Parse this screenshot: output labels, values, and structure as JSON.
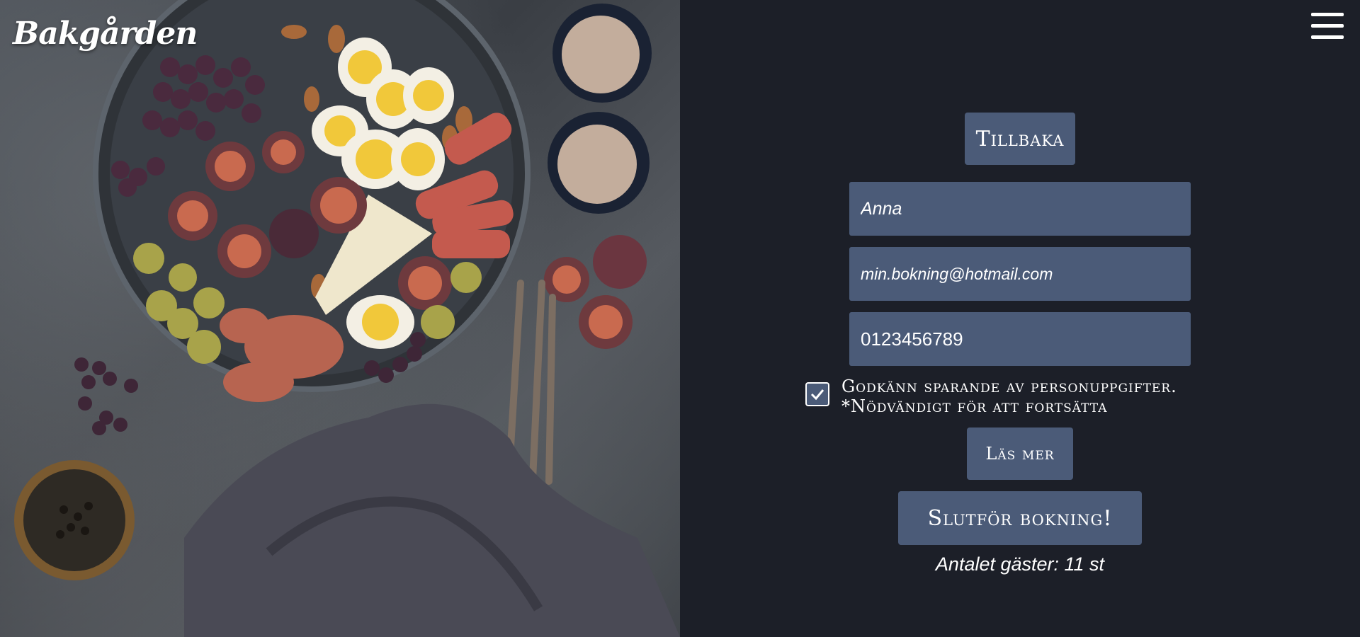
{
  "brand": {
    "logo_text": "Bakgården"
  },
  "header": {
    "menu_icon": "hamburger-menu-icon"
  },
  "form": {
    "back_label": "Tillbaka",
    "name_value": "Anna",
    "email_value": "min.bokning@hotmail.com",
    "phone_value": "0123456789",
    "consent_checked": true,
    "consent_line1": "Godkänn sparande av personuppgifter.",
    "consent_line2": "*Nödvändigt för att fortsätta",
    "read_more_label": "Läs mer",
    "submit_label": "Slutför bokning!",
    "guests_text": "Antalet gäster: 11 st"
  },
  "colors": {
    "background": "#1c1f28",
    "field": "#4b5b78",
    "text": "#ffffff"
  }
}
